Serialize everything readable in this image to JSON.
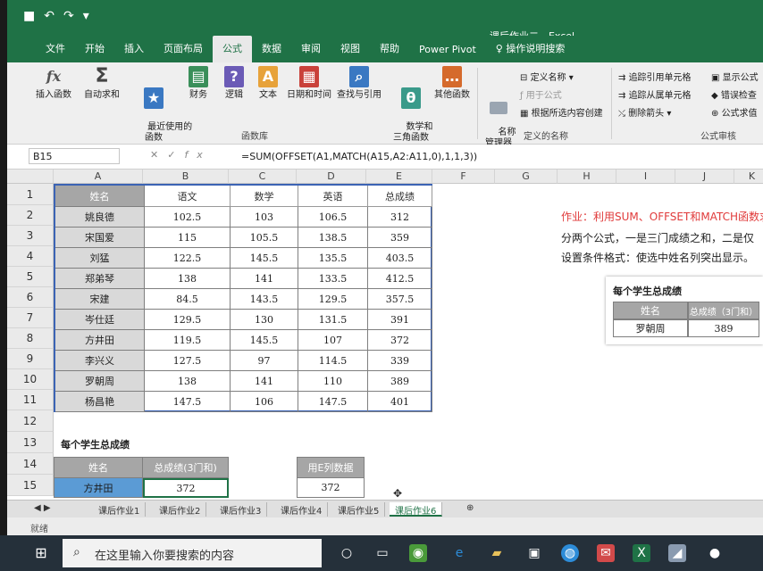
{
  "window": {
    "title": "课后作业二 - Excel"
  },
  "ribbon_tabs": [
    "文件",
    "开始",
    "插入",
    "页面布局",
    "公式",
    "数据",
    "审阅",
    "视图",
    "帮助",
    "Power Pivot"
  ],
  "active_tab": "公式",
  "tell_me": "操作说明搜索",
  "ribbon": {
    "insert_function": "插入函数",
    "autosum": "自动求和",
    "recent": "最近使用的\n函数",
    "financial": "财务",
    "logical": "逻辑",
    "text": "文本",
    "datetime": "日期和时间",
    "lookup": "查找与引用",
    "math": "数学和\n三角函数",
    "more": "其他函数",
    "group_library": "函数库",
    "name_manager": "名称\n管理器",
    "define_name": "定义名称",
    "use_in_formula": "用于公式",
    "create_from_selection": "根据所选内容创建",
    "group_names": "定义的名称",
    "trace_precedents": "追踪引用单元格",
    "trace_dependents": "追踪从属单元格",
    "remove_arrows": "删除箭头",
    "show_formulas": "显示公式",
    "error_checking": "错误检查",
    "evaluate": "公式求值",
    "group_audit": "公式审核"
  },
  "formula_bar": {
    "name_box": "B15",
    "formula": "=SUM(OFFSET(A1,MATCH(A15,A2:A11,0),1,1,3))"
  },
  "columns": [
    "A",
    "B",
    "C",
    "D",
    "E",
    "F",
    "G",
    "H",
    "I",
    "J",
    "K"
  ],
  "rows": [
    "1",
    "2",
    "3",
    "4",
    "5",
    "6",
    "7",
    "8",
    "9",
    "10",
    "11",
    "12",
    "13",
    "14",
    "15"
  ],
  "table": {
    "headers": [
      "姓名",
      "语文",
      "数学",
      "英语",
      "总成绩"
    ],
    "rows": [
      [
        "姚良德",
        "102.5",
        "103",
        "106.5",
        "312"
      ],
      [
        "宋国爱",
        "115",
        "105.5",
        "138.5",
        "359"
      ],
      [
        "刘猛",
        "122.5",
        "145.5",
        "135.5",
        "403.5"
      ],
      [
        "郑弟琴",
        "138",
        "141",
        "133.5",
        "412.5"
      ],
      [
        "宋建",
        "84.5",
        "143.5",
        "129.5",
        "357.5"
      ],
      [
        "岑仕廷",
        "129.5",
        "130",
        "131.5",
        "391"
      ],
      [
        "方井田",
        "119.5",
        "145.5",
        "107",
        "372"
      ],
      [
        "李兴义",
        "127.5",
        "97",
        "114.5",
        "339"
      ],
      [
        "罗朝周",
        "138",
        "141",
        "110",
        "389"
      ],
      [
        "杨昌艳",
        "147.5",
        "106",
        "147.5",
        "401"
      ]
    ]
  },
  "notes": {
    "line1": "作业：利用SUM、OFFSET和MATCH函数求",
    "line2": "分两个公式，一是三门成绩之和，二是仅",
    "line3": "设置条件格式：使选中姓名列突出显示。"
  },
  "side_box": {
    "title": "每个学生总成绩",
    "h1": "姓名",
    "h2": "总成绩（3门和）",
    "name": "罗朝周",
    "value": "389"
  },
  "bottom": {
    "title": "每个学生总成绩",
    "h1": "姓名",
    "h2": "总成绩(3门和)",
    "h3": "用E列数据",
    "name": "方井田",
    "value": "372",
    "value2": "372"
  },
  "sheet_tabs": [
    "课后作业1",
    "课后作业2",
    "课后作业3",
    "课后作业4",
    "课后作业5",
    "课后作业6"
  ],
  "active_sheet": "课后作业6",
  "status": "就绪",
  "taskbar": {
    "search_placeholder": "在这里输入你要搜索的内容"
  }
}
